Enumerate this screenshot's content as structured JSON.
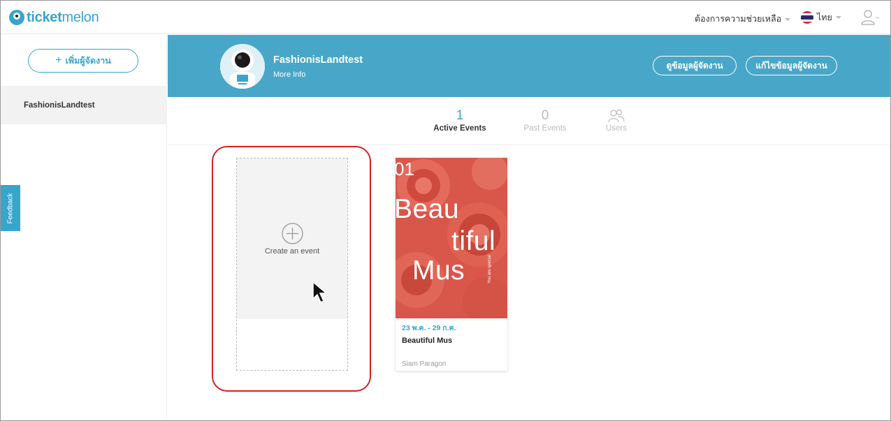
{
  "brand": {
    "logo_bold": "ticket",
    "logo_light": "melon",
    "accent": "#37a5cc"
  },
  "header": {
    "help_label": "ต้องการความช่วยเหลือ",
    "language_label": "ไทย"
  },
  "sidebar": {
    "add_organizer_label": "เพิ่มผู้จัดงาน",
    "organizers": [
      "FashionisLandtest"
    ],
    "feedback_label": "Feedback"
  },
  "banner": {
    "org_name": "FashionisLandtest",
    "more_info": "More Info",
    "view_button": "ดูข้อมูลผู้จัดงาน",
    "edit_button": "แก้ไขข้อมูลผู้จัดงาน",
    "bg_color": "#48a7c8"
  },
  "tabs": [
    {
      "count": "1",
      "label": "Active Events"
    },
    {
      "count": "0",
      "label": "Past Events"
    },
    {
      "count": "",
      "label": "Users"
    }
  ],
  "create_card": {
    "label": "Create an event"
  },
  "event": {
    "poster_number": "01",
    "poster_lines": [
      "Beau",
      "tiful",
      "Mus"
    ],
    "poster_side_text": "You are special",
    "date_range": "23 พ.ค. - 29 ก.ค.",
    "title": "Beautiful Mus",
    "venue": "Siam Paragon"
  },
  "highlight_color": "#d42121"
}
